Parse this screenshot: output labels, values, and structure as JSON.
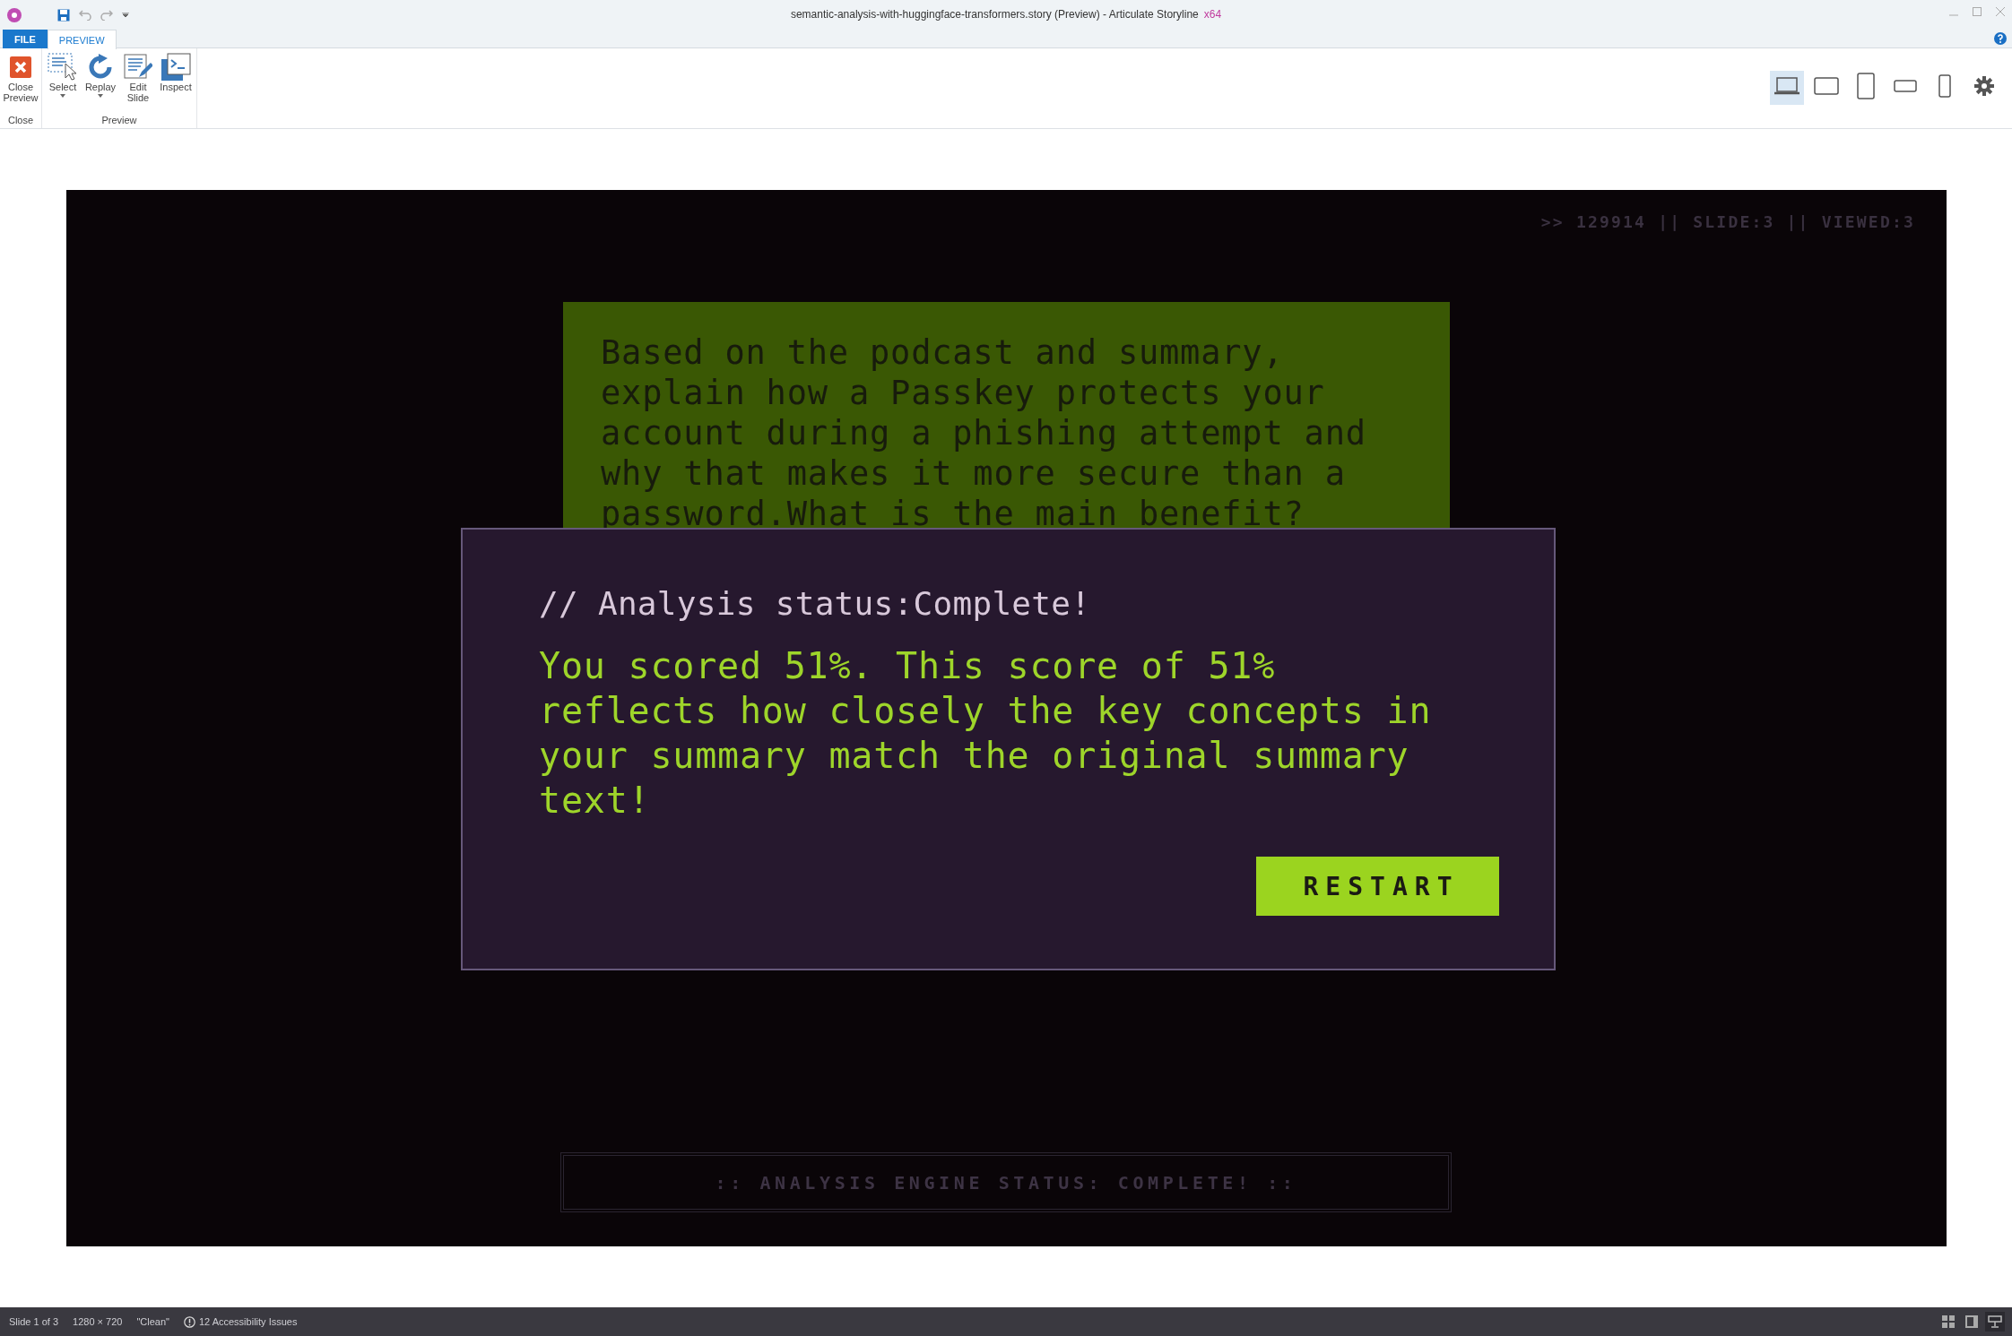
{
  "window": {
    "title": "semantic-analysis-with-huggingface-transformers.story (Preview) -  Articulate Storyline",
    "edition": "x64"
  },
  "ribbon_tabs": [
    {
      "label": "FILE",
      "kind": "file",
      "selected": false
    },
    {
      "label": "PREVIEW",
      "kind": "tab",
      "selected": true
    }
  ],
  "ribbon_groups": [
    {
      "label": "Close",
      "buttons": [
        {
          "label": "Close Preview",
          "kind": "close",
          "dropdown": false
        }
      ]
    },
    {
      "label": "Preview",
      "buttons": [
        {
          "label": "Select",
          "kind": "select",
          "dropdown": true
        },
        {
          "label": "Replay",
          "kind": "replay",
          "dropdown": true
        },
        {
          "label": "Edit Slide",
          "kind": "edit",
          "dropdown": false
        },
        {
          "label": "Inspect",
          "kind": "inspect",
          "dropdown": false
        }
      ]
    }
  ],
  "device_views": [
    {
      "kind": "laptop",
      "selected": true
    },
    {
      "kind": "tablet-landscape",
      "selected": false
    },
    {
      "kind": "tablet-portrait",
      "selected": false
    },
    {
      "kind": "phone-landscape",
      "selected": false
    },
    {
      "kind": "phone-portrait",
      "selected": false
    },
    {
      "kind": "settings",
      "selected": false
    }
  ],
  "slide": {
    "header": ">> 129914 || SLIDE:3 || VIEWED:3",
    "question": "Based on the podcast and summary, explain how a Passkey protects your account during a phishing attempt and why that makes it more secure than a password.What is the main benefit?",
    "dialog": {
      "title": "// Analysis status:Complete!",
      "message": "You scored 51%. This score of 51% reflects how closely the key concepts in your summary match the original summary text!",
      "button": "RESTART"
    },
    "footer": ":: ANALYSIS ENGINE STATUS: COMPLETE! ::"
  },
  "status_bar": {
    "items": [
      "Slide 1 of 3",
      "1280 × 720",
      "\"Clean\""
    ],
    "issues": "12 Accessibility Issues",
    "views": [
      {
        "kind": "grid",
        "selected": false
      },
      {
        "kind": "normal",
        "selected": false
      },
      {
        "kind": "presenter",
        "selected": true
      }
    ]
  }
}
